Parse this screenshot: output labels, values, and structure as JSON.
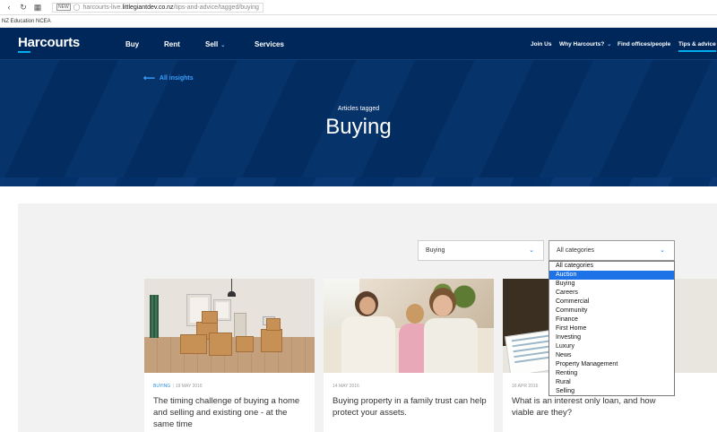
{
  "browser": {
    "url_host": "harcourts-live.",
    "url_domain": "littlegiantdev.co.nz",
    "url_path": "/tips-and-advice/tagged/buying",
    "bookmark": "NZ Education NCEA"
  },
  "header": {
    "logo": "Harcourts",
    "main_nav": [
      {
        "label": "Buy"
      },
      {
        "label": "Rent"
      },
      {
        "label": "Sell"
      },
      {
        "label": "Services"
      }
    ],
    "util_nav": [
      {
        "label": "Join Us"
      },
      {
        "label": "Why Harcourts?"
      },
      {
        "label": "Find offices/people"
      },
      {
        "label": "Tips & advice"
      }
    ]
  },
  "hero": {
    "back_link": "All insights",
    "kicker": "Articles tagged",
    "title": "Buying"
  },
  "filters": {
    "tag_select": "Buying",
    "category_select": "All categories",
    "category_options": [
      "All categories",
      "Auction",
      "Buying",
      "Careers",
      "Commercial",
      "Community",
      "Finance",
      "First Home",
      "Investing",
      "Luxury",
      "News",
      "Property Management",
      "Renting",
      "Rural",
      "Selling"
    ],
    "highlighted_option": "Auction"
  },
  "articles": [
    {
      "tag": "BUYING",
      "date": "19 MAY 2016",
      "title": "The timing challenge of buying a home and selling and existing one - at the same time"
    },
    {
      "tag": "",
      "date": "14 MAY 2016",
      "title": "Buying property in a family trust can help protect your assets."
    },
    {
      "tag": "",
      "date": "16 APR 2016",
      "title": "What is an interest only loan, and how viable are they?"
    }
  ],
  "colors": {
    "navy": "#002b5c",
    "accent": "#00aeef",
    "link": "#2a8be0",
    "highlight": "#1e72e8"
  }
}
